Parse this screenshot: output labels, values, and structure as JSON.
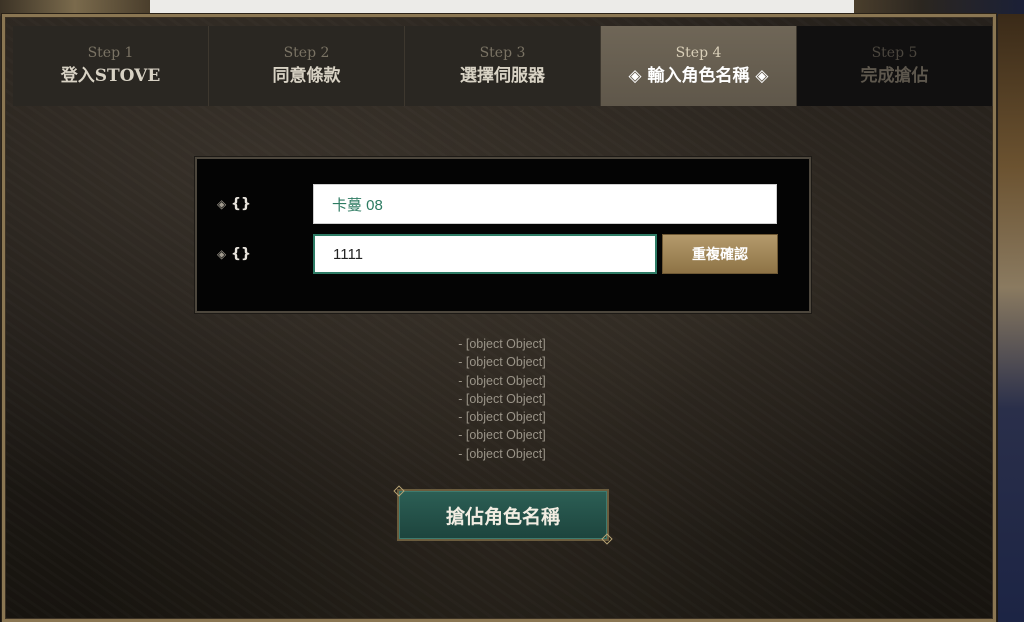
{
  "steps": [
    {
      "step": "Step 1",
      "label": "登入STOVE"
    },
    {
      "step": "Step 2",
      "label": "同意條款"
    },
    {
      "step": "Step 3",
      "label": "選擇伺服器"
    },
    {
      "step": "Step 4",
      "label": "◈ 輸入角色名稱 ◈"
    },
    {
      "step": "Step 5",
      "label": "完成搶佔"
    }
  ],
  "form": {
    "row1": {
      "bullet": "◈",
      "key": "{}",
      "value": "卡蔓 08"
    },
    "row2": {
      "bullet": "◈",
      "key": "{}",
      "value": "1111",
      "dup_check_label": "重複確認"
    }
  },
  "notes": [
    "- [object Object]",
    "- [object Object]",
    "- [object Object]",
    "- [object Object]",
    "- [object Object]",
    "- [object Object]",
    "- [object Object]"
  ],
  "submit_label": "搶佔角色名稱"
}
